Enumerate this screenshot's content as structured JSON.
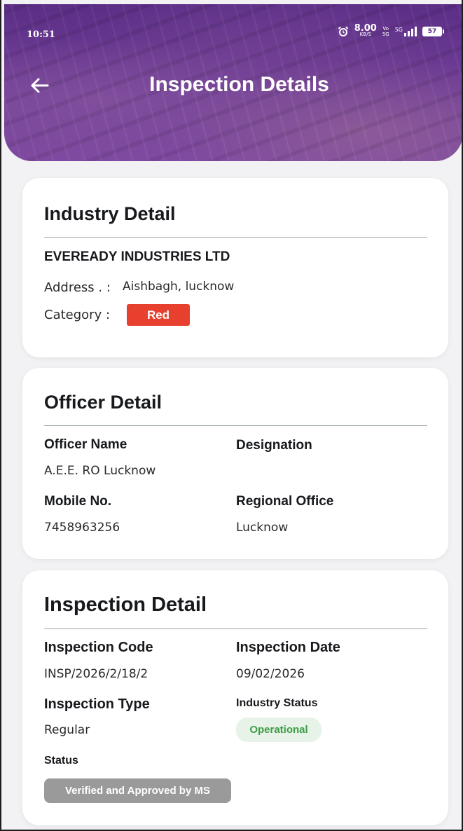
{
  "status_bar": {
    "time": "10:51",
    "speed_value": "8.00",
    "speed_unit": "KB/S",
    "volte_top": "Vo",
    "volte_bottom": "5G",
    "network": "5G",
    "battery": "57"
  },
  "header": {
    "title": "Inspection Details"
  },
  "industry": {
    "section_title": "Industry Detail",
    "name": "EVEREADY INDUSTRIES LTD",
    "address_label": "Address . :",
    "address_value": "Aishbagh, lucknow",
    "category_label": "Category :",
    "category_value": "Red"
  },
  "officer": {
    "section_title": "Officer Detail",
    "name_label": "Officer Name",
    "name_value": "A.E.E. RO Lucknow",
    "designation_label": "Designation",
    "designation_value": "",
    "mobile_label": "Mobile No.",
    "mobile_value": "7458963256",
    "regional_label": "Regional Office",
    "regional_value": "Lucknow"
  },
  "inspection": {
    "section_title": "Inspection Detail",
    "code_label": "Inspection Code",
    "code_value": "INSP/2026/2/18/2",
    "date_label": "Inspection Date",
    "date_value": "09/02/2026",
    "type_label": "Inspection Type",
    "type_value": "Regular",
    "industry_status_label": "Industry Status",
    "industry_status_value": "Operational",
    "status_label": "Status",
    "status_value": "Verified and Approved by MS"
  },
  "colors": {
    "header_purple": "#6d3c94",
    "category_red": "#e8402f",
    "operational_green": "#3d9b46",
    "status_grey": "#9a9a9a"
  },
  "icons": {
    "back": "arrow-left-icon",
    "alarm": "alarm-clock-icon",
    "signal": "signal-bars-icon",
    "battery": "battery-icon"
  }
}
